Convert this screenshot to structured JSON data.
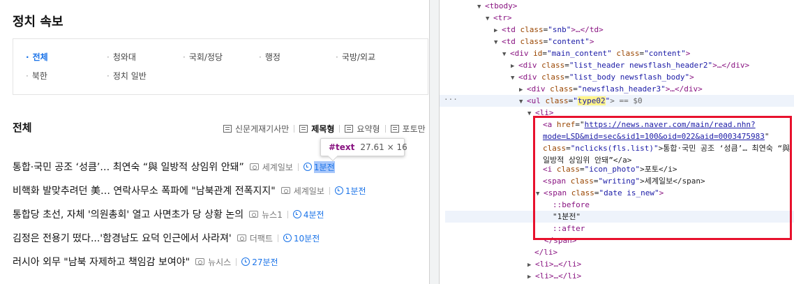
{
  "page": {
    "title": "정치 속보",
    "categories": [
      {
        "label": "전체",
        "active": true
      },
      {
        "label": "청와대",
        "active": false
      },
      {
        "label": "국회/정당",
        "active": false
      },
      {
        "label": "행정",
        "active": false
      },
      {
        "label": "국방/외교",
        "active": false
      },
      {
        "label": "북한",
        "active": false
      },
      {
        "label": "정치 일반",
        "active": false
      }
    ],
    "section_title": "전체",
    "view_modes": [
      "신문게재기사만",
      "제목형",
      "요약형",
      "포토만"
    ],
    "active_view_mode": "제목형",
    "tooltip": {
      "tag": "#text",
      "size": "27.61 × 16"
    },
    "news": [
      {
        "headline": "통합·국민 공조 ‘성큼’… 최연숙 “與 일방적 상임위 안돼”",
        "press": "세계일보",
        "time": "1분전"
      },
      {
        "headline": "비핵화 발맞추려던 美… 연락사무소 폭파에 \"남북관계 전폭지지\"",
        "press": "세계일보",
        "time": "1분전"
      },
      {
        "headline": "통합당 초선, 자체 '의원총회' 열고 사면초가 당 상황 논의",
        "press": "뉴스1",
        "time": "4분전"
      },
      {
        "headline": "김정은 전용기 떴다...'함경남도 요덕 인근에서 사라져'",
        "press": "더팩트",
        "time": "10분전"
      },
      {
        "headline": "러시아 외무 \"남북 자제하고 책임감 보여야\"",
        "press": "뉴시스",
        "time": "27분전"
      }
    ]
  },
  "devtools": {
    "lines": {
      "tbody": "<tbody>",
      "tr": "<tr>",
      "td_snb_tag": "<td",
      "td_snb_attr": "class",
      "td_snb_val": "\"snb\"",
      "td_snb_end": ">…</td>",
      "td_content_tag": "<td",
      "td_content_attr": "class",
      "td_content_val": "\"content\"",
      "td_content_end": ">",
      "div_main_tag": "<div",
      "div_main_attr1": "id",
      "div_main_val1": "\"main_content\"",
      "div_main_attr2": "class",
      "div_main_val2": "\"content\"",
      "div_main_end": ">",
      "div_header_tag": "<div",
      "div_header_attr": "class",
      "div_header_val": "\"list_header newsflash_header2\"",
      "div_header_end": ">…</div>",
      "div_body_tag": "<div",
      "div_body_attr": "class",
      "div_body_val": "\"list_body newsflash_body\"",
      "div_body_end": ">",
      "div_h3_tag": "<div",
      "div_h3_attr": "class",
      "div_h3_val": "\"newsflash_header3\"",
      "div_h3_end": ">…</div>",
      "ul_tag": "<ul",
      "ul_attr": "class",
      "ul_val_q1": "\"",
      "ul_val": "type02",
      "ul_val_q2": "\"",
      "ul_end": "> == $0",
      "li": "<li>",
      "a_tag": "<a",
      "a_attr": "href",
      "a_href": "https://news.naver.com/main/read.nhn?mode=LSD&mid=sec&sid1=100&oid=022&aid=0003475983",
      "a_class_attr": "class",
      "a_class_val": "\"nclicks(fls.list)\"",
      "a_text": ">통합·국민 공조 ‘성큼’… 최연숙 “與 일방적 상임위 안돼”</a>",
      "i_tag": "<i",
      "i_attr": "class",
      "i_val": "\"icon_photo\"",
      "i_text": ">포토</i>",
      "span_w_tag": "<span",
      "span_w_attr": "class",
      "span_w_val": "\"writing\"",
      "span_w_text": ">세계일보</span>",
      "span_d_tag": "<span",
      "span_d_attr": "class",
      "span_d_val": "\"date is_new\"",
      "span_d_end": ">",
      "before": "::before",
      "text_node": "\"1분전\"",
      "after": "::after",
      "span_close": "</span>",
      "li_close": "</li>",
      "li_collapsed": "<li>…</li>",
      "dots": "···"
    }
  },
  "colors": {
    "accent": "#1a73e8",
    "highlight_red": "#e8112d",
    "tag": "#881280",
    "attr_name": "#994500",
    "attr_value": "#1a1aa6"
  }
}
